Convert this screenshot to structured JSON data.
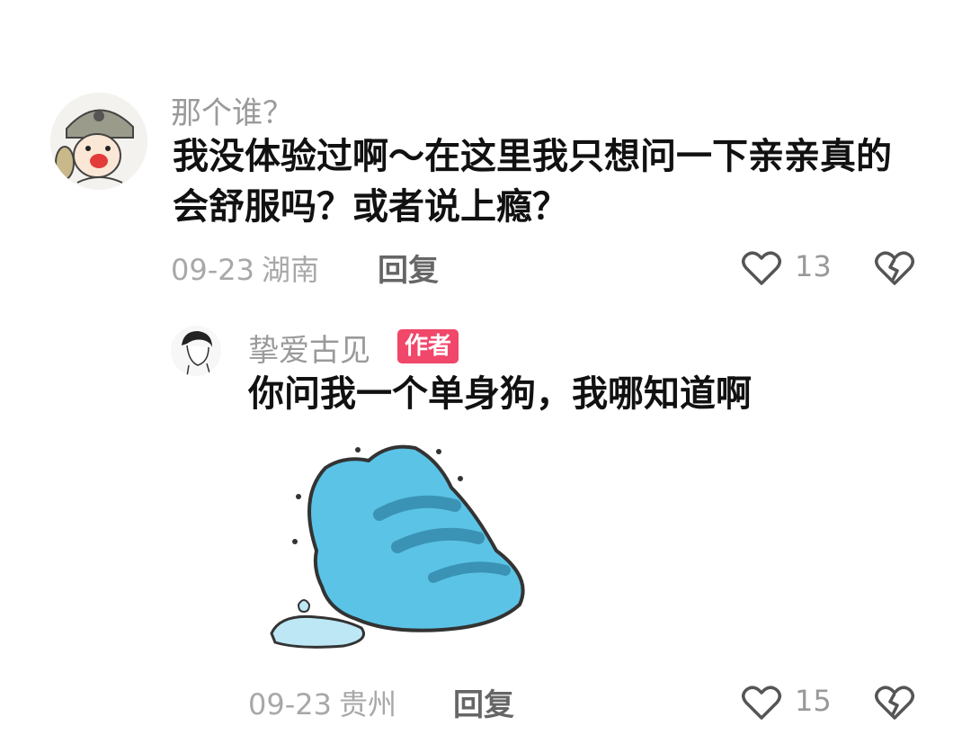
{
  "comment": {
    "username": "那个谁？",
    "text": "我没体验过啊～在这里我只想问一下亲亲真的会舒服吗？或者说上瘾？",
    "date": "09-23",
    "location": "湖南",
    "reply_label": "回复",
    "like_count": "13",
    "avatar_icon": "helmet-kid-avatar"
  },
  "reply": {
    "username": "挚爱古见",
    "badge": "作者",
    "text": "你问我一个单身狗，我哪知道啊",
    "date": "09-23",
    "location": "贵州",
    "reply_label": "回复",
    "like_count": "15",
    "sticker_icon": "blue-cat-sticker",
    "avatar_icon": "sketch-boy-avatar"
  },
  "colors": {
    "badge": "#f0476a",
    "meta": "#a8a8a8",
    "sticker_blue": "#5bc3e6"
  }
}
